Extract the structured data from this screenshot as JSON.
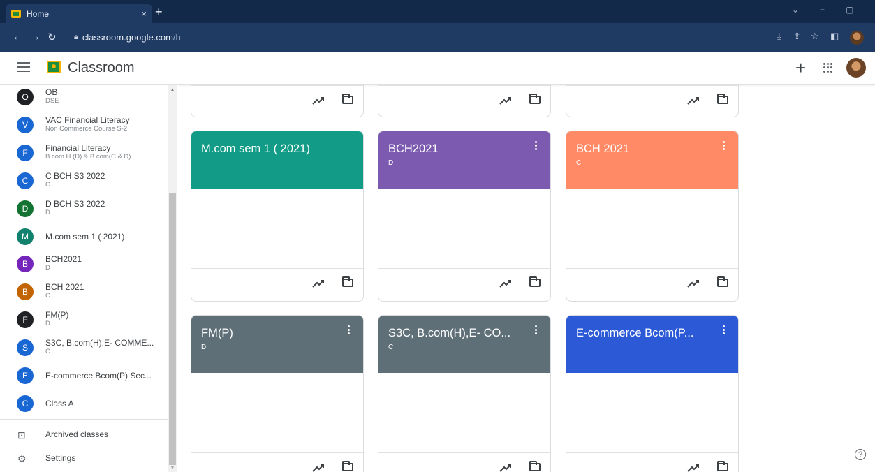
{
  "browser": {
    "tab_title": "Home",
    "tab_close": "×",
    "new_tab": "+",
    "url_host": "classroom.google.com",
    "url_path": "/h",
    "min": "−",
    "restore": "▢",
    "dropdown": "⌄"
  },
  "header": {
    "title": "Classroom",
    "plus": "+"
  },
  "sidebar": {
    "classes": [
      {
        "letter": "O",
        "name": "OB",
        "sub": "DSE",
        "color": "#202124"
      },
      {
        "letter": "V",
        "name": "VAC Financial Literacy",
        "sub": "Non Commerce Course S-2",
        "color": "#1967d2"
      },
      {
        "letter": "F",
        "name": "Financial Literacy",
        "sub": "B.com H (D) & B.com(C & D)",
        "color": "#1967d2"
      },
      {
        "letter": "C",
        "name": "C BCH S3 2022",
        "sub": "C",
        "color": "#1967d2"
      },
      {
        "letter": "D",
        "name": "D BCH S3 2022",
        "sub": "D",
        "color": "#137333"
      },
      {
        "letter": "M",
        "name": "M.com sem 1 ( 2021)",
        "sub": "",
        "color": "#12826e"
      },
      {
        "letter": "B",
        "name": "BCH2021",
        "sub": "D",
        "color": "#7627bb"
      },
      {
        "letter": "B",
        "name": "BCH 2021",
        "sub": "C",
        "color": "#c26401"
      },
      {
        "letter": "F",
        "name": "FM(P)",
        "sub": "D",
        "color": "#202124"
      },
      {
        "letter": "S",
        "name": "S3C, B.com(H),E- COMME...",
        "sub": "C",
        "color": "#1967d2"
      },
      {
        "letter": "E",
        "name": "E-commerce Bcom(P) Sec...",
        "sub": "",
        "color": "#1967d2"
      },
      {
        "letter": "C",
        "name": "Class A",
        "sub": "",
        "color": "#1967d2"
      }
    ],
    "archived_label": "Archived classes",
    "settings_label": "Settings"
  },
  "cards": [
    {
      "title": "M.com sem 1 ( 2021)",
      "section": "",
      "color": "#129c87"
    },
    {
      "title": "BCH2021",
      "section": "D",
      "color": "#7b5ab0"
    },
    {
      "title": "BCH 2021",
      "section": "C",
      "color": "#ff8a65"
    },
    {
      "title": "FM(P)",
      "section": "D",
      "color": "#5f6f78"
    },
    {
      "title": "S3C, B.com(H),E- CO...",
      "section": "C",
      "color": "#5f6f78"
    },
    {
      "title": "E-commerce Bcom(P...",
      "section": "",
      "color": "#2c5ad6"
    }
  ],
  "help": "?"
}
